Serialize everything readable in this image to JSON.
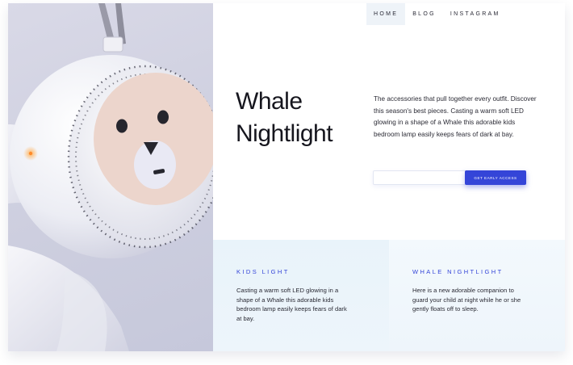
{
  "nav": {
    "items": [
      "HOME",
      "BLOG",
      "INSTAGRAM"
    ],
    "active": "HOME"
  },
  "hero": {
    "headline_line1": "Whale",
    "headline_line2": "Nightlight",
    "description": "The accessories that pull together every outfit. Discover this season's best pieces. Casting a warm soft LED glowing in a shape of a Whale this adorable kids bedroom lamp easily keeps fears of dark at bay."
  },
  "signup": {
    "email_value": "",
    "button_label": "GET EARLY ACCESS"
  },
  "features": [
    {
      "title": "KIDS LIGHT",
      "text": "Casting a warm soft LED glowing in a shape of a Whale this adorable kids bedroom lamp easily keeps fears of dark at bay."
    },
    {
      "title": "WHALE NIGHTLIGHT",
      "text": "Here is a new adorable companion to guard your child at night while he or she gently floats off to sleep."
    }
  ],
  "colors": {
    "accent": "#3445d8",
    "panel_bg": "#e9f3fa",
    "hero_bg": "#d3d4e4",
    "lamp_face": "#ecd5cc",
    "text": "#1d1d25"
  }
}
